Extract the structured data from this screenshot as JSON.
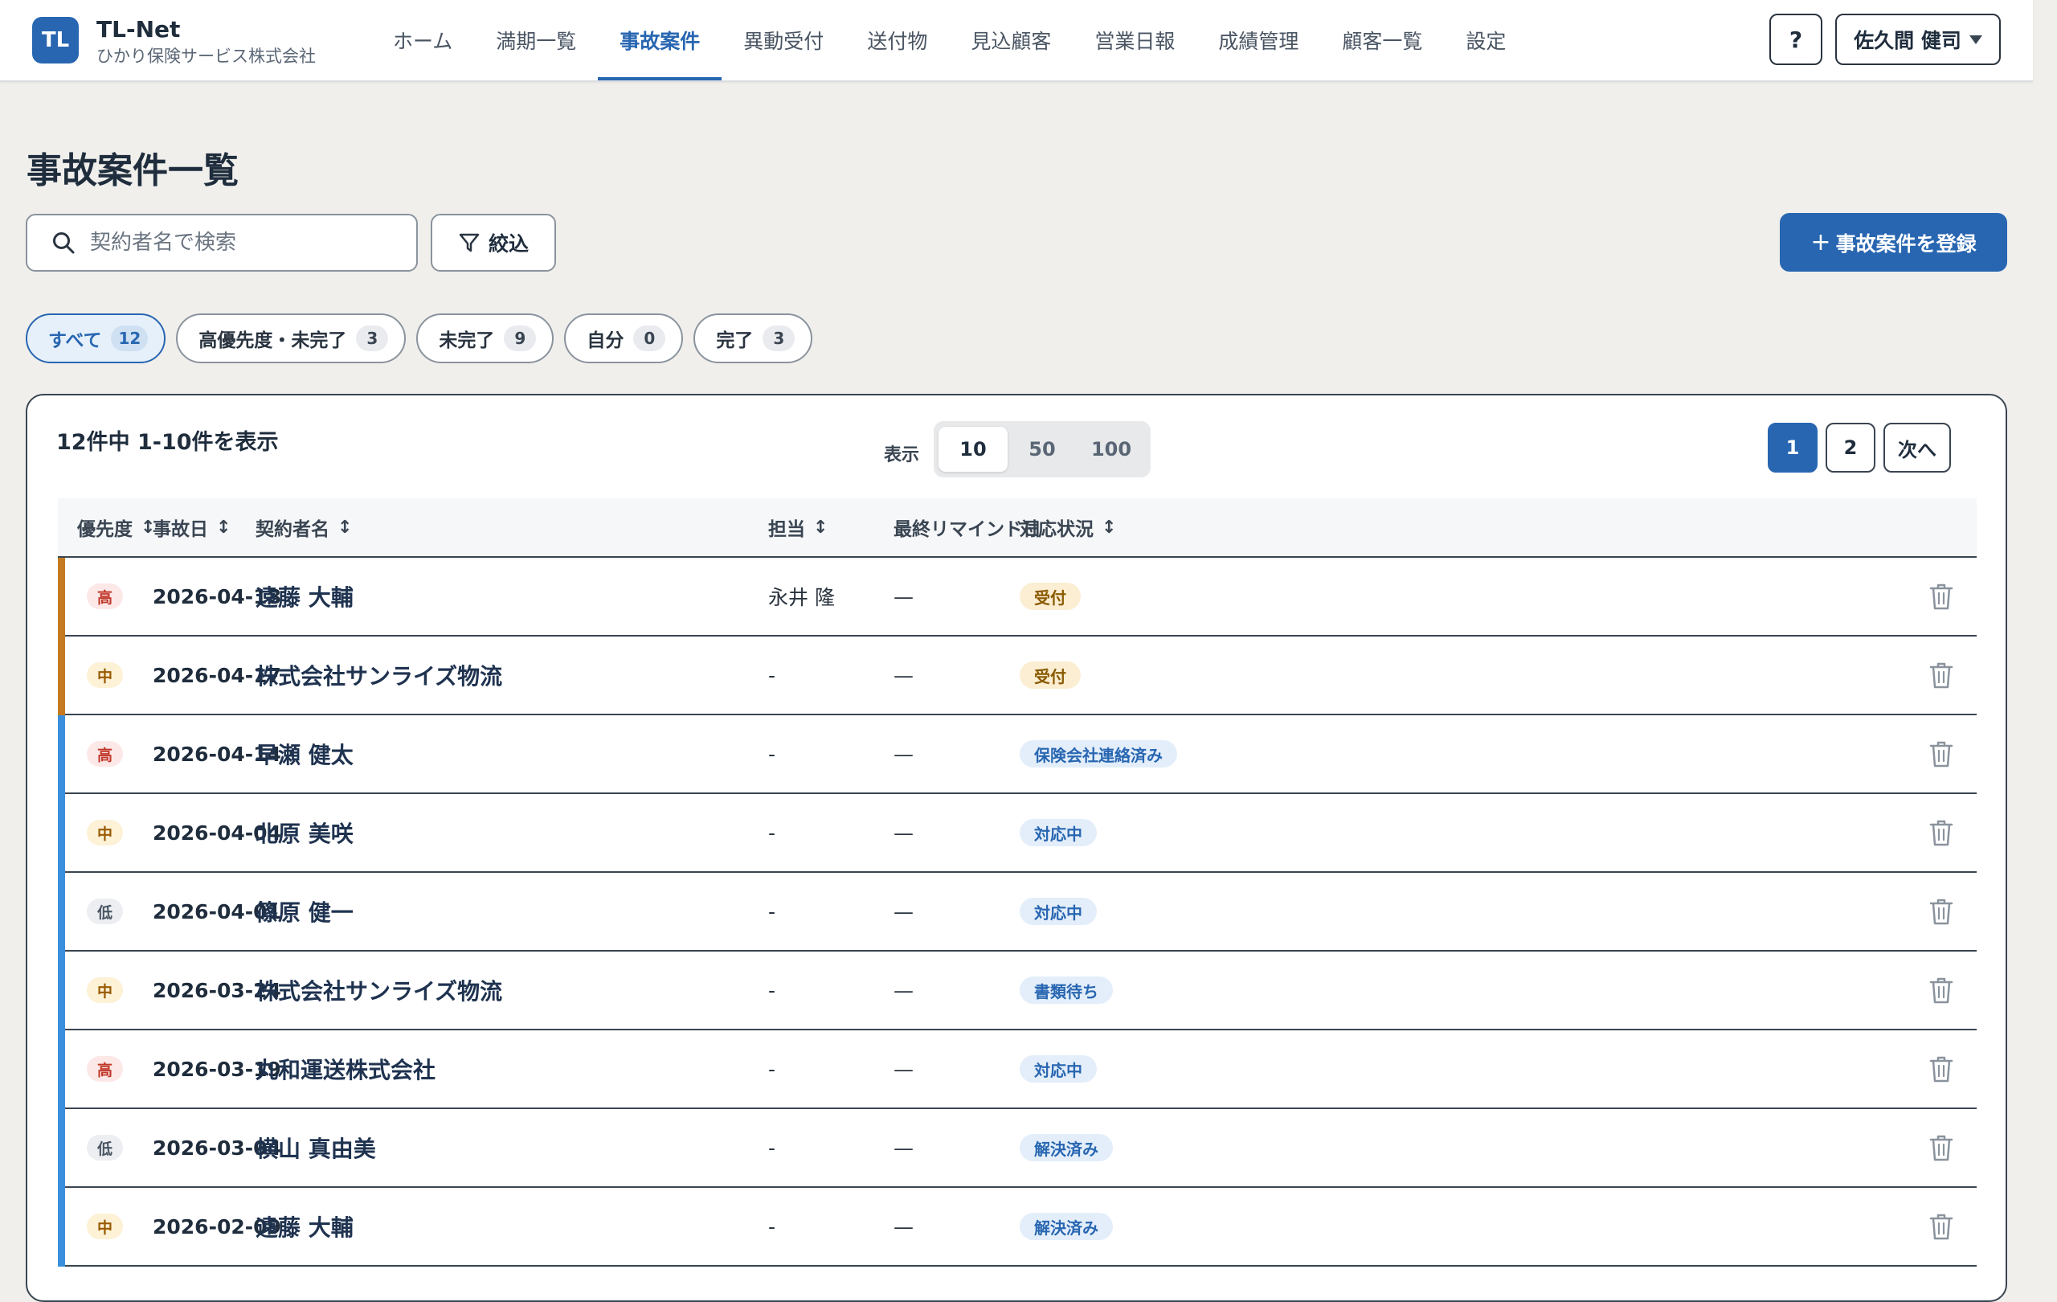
{
  "colors": {
    "accent": "#2866b1",
    "edge_warning": "#c47a1e",
    "edge_info": "#3a8fdc",
    "prio_high_bg": "#fde8e8",
    "prio_high_fg": "#c0392b",
    "prio_mid_bg": "#fdf1d6",
    "prio_mid_fg": "#9a5a00",
    "prio_low_bg": "#eceef1",
    "prio_low_fg": "#4a5563",
    "status_received_bg": "#fbeed3",
    "status_received_fg": "#8a5a00",
    "status_info_bg": "#e3eefa",
    "status_info_fg": "#2866b1"
  },
  "header": {
    "logo_text": "TL",
    "brand_name": "TL-Net",
    "company": "ひかり保険サービス株式会社",
    "nav": [
      {
        "label": "ホーム",
        "active": false
      },
      {
        "label": "満期一覧",
        "active": false
      },
      {
        "label": "事故案件",
        "active": true
      },
      {
        "label": "異動受付",
        "active": false
      },
      {
        "label": "送付物",
        "active": false
      },
      {
        "label": "見込顧客",
        "active": false
      },
      {
        "label": "営業日報",
        "active": false
      },
      {
        "label": "成績管理",
        "active": false
      },
      {
        "label": "顧客一覧",
        "active": false
      },
      {
        "label": "設定",
        "active": false
      }
    ],
    "help_label": "?",
    "user_name": "佐久間 健司"
  },
  "page": {
    "title": "事故案件一覧",
    "search_placeholder": "契約者名で検索",
    "filter_label": "絞込",
    "register_label": "事故案件を登録",
    "register_icon": "+"
  },
  "chips": [
    {
      "label": "すべて",
      "count": "12",
      "active": true
    },
    {
      "label": "高優先度・未完了",
      "count": "3",
      "active": false
    },
    {
      "label": "未完了",
      "count": "9",
      "active": false
    },
    {
      "label": "自分",
      "count": "0",
      "active": false
    },
    {
      "label": "完了",
      "count": "3",
      "active": false
    }
  ],
  "panel": {
    "result_text": "12件中 1-10件を表示",
    "size_label": "表示",
    "size_options": [
      {
        "label": "10",
        "active": true
      },
      {
        "label": "50",
        "active": false
      },
      {
        "label": "100",
        "active": false
      }
    ],
    "pager": [
      {
        "label": "1",
        "active": true
      },
      {
        "label": "2",
        "active": false
      },
      {
        "label": "次へ",
        "active": false
      }
    ]
  },
  "table": {
    "columns": [
      {
        "label": "優先度",
        "sortable": true
      },
      {
        "label": "事故日",
        "sortable": true
      },
      {
        "label": "契約者名",
        "sortable": true
      },
      {
        "label": "担当",
        "sortable": true
      },
      {
        "label": "最終リマインド日",
        "sortable": false
      },
      {
        "label": "対応状況",
        "sortable": true
      }
    ],
    "sort_icon": "↕",
    "rows": [
      {
        "edge": "warning",
        "priority": "高",
        "prio_level": "high",
        "date": "2026-04-18",
        "name": "遠藤 大輔",
        "assignee": "永井 隆",
        "remind": "—",
        "status": "受付",
        "status_kind": "received"
      },
      {
        "edge": "warning",
        "priority": "中",
        "prio_level": "mid",
        "date": "2026-04-17",
        "name": "株式会社サンライズ物流",
        "assignee": "-",
        "remind": "—",
        "status": "受付",
        "status_kind": "received"
      },
      {
        "edge": "info",
        "priority": "高",
        "prio_level": "high",
        "date": "2026-04-14",
        "name": "早瀬 健太",
        "assignee": "-",
        "remind": "—",
        "status": "保険会社連絡済み",
        "status_kind": "info"
      },
      {
        "edge": "info",
        "priority": "中",
        "prio_level": "mid",
        "date": "2026-04-04",
        "name": "北原 美咲",
        "assignee": "-",
        "remind": "—",
        "status": "対応中",
        "status_kind": "info"
      },
      {
        "edge": "info",
        "priority": "低",
        "prio_level": "low",
        "date": "2026-04-01",
        "name": "篠原 健一",
        "assignee": "-",
        "remind": "—",
        "status": "対応中",
        "status_kind": "info"
      },
      {
        "edge": "info",
        "priority": "中",
        "prio_level": "mid",
        "date": "2026-03-24",
        "name": "株式会社サンライズ物流",
        "assignee": "-",
        "remind": "—",
        "status": "書類待ち",
        "status_kind": "info"
      },
      {
        "edge": "info",
        "priority": "高",
        "prio_level": "high",
        "date": "2026-03-19",
        "name": "丸和運送株式会社",
        "assignee": "-",
        "remind": "—",
        "status": "対応中",
        "status_kind": "info"
      },
      {
        "edge": "info",
        "priority": "低",
        "prio_level": "low",
        "date": "2026-03-04",
        "name": "横山 真由美",
        "assignee": "-",
        "remind": "—",
        "status": "解決済み",
        "status_kind": "info"
      },
      {
        "edge": "info",
        "priority": "中",
        "prio_level": "mid",
        "date": "2026-02-09",
        "name": "遠藤 大輔",
        "assignee": "-",
        "remind": "—",
        "status": "解決済み",
        "status_kind": "info"
      }
    ]
  }
}
